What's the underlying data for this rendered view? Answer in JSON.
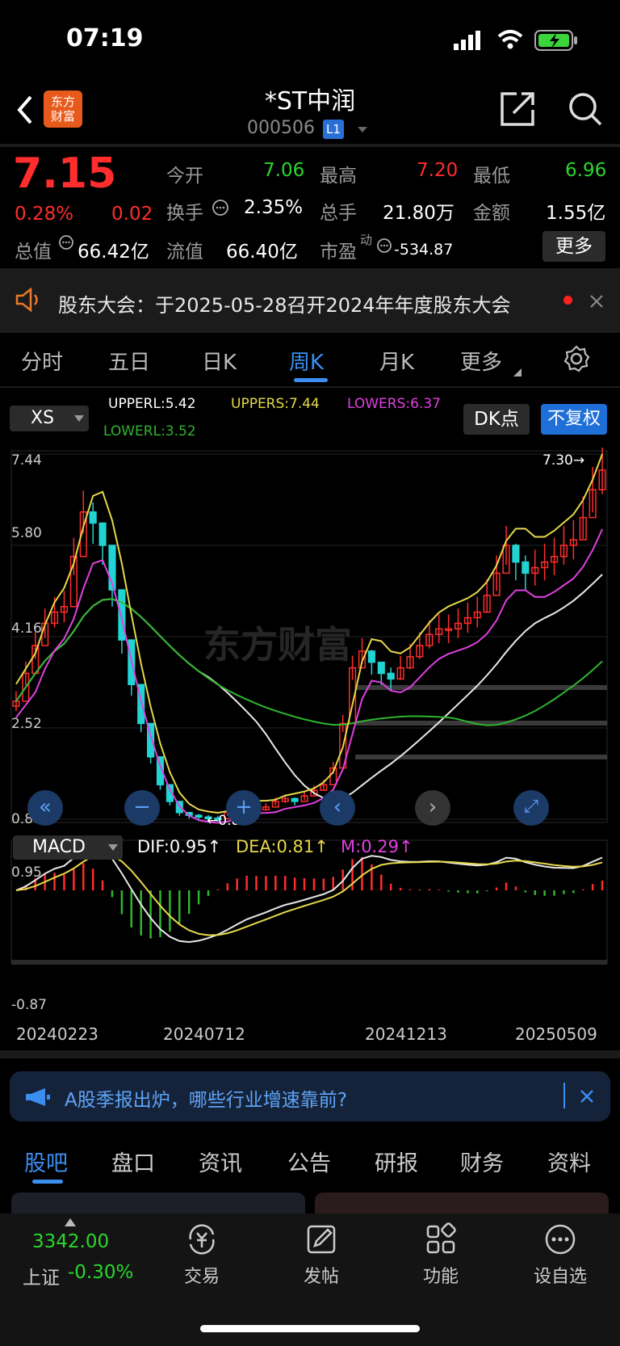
{
  "status": {
    "time": "07:19"
  },
  "header": {
    "title": "*ST中润",
    "code": "000506",
    "level": "L1",
    "logo_line1": "东方",
    "logo_line2": "财富"
  },
  "quote": {
    "price": "7.15",
    "change_pct": "0.28%",
    "change": "0.02",
    "open_label": "今开",
    "open": "7.06",
    "high_label": "最高",
    "high": "7.20",
    "low_label": "最低",
    "low": "6.96",
    "turnover_label": "换手",
    "turnover": "2.35%",
    "volume_label": "总手",
    "volume": "21.80万",
    "amount_label": "金额",
    "amount": "1.55亿",
    "mktcap_label": "总值",
    "mktcap": "66.42亿",
    "float_label": "流值",
    "float": "66.40亿",
    "pe_label": "市盈",
    "pe_sup": "动",
    "pe": "-534.87",
    "more_label": "更多"
  },
  "notice": {
    "text": "股东大会：于2025-05-28召开2024年年度股东大会"
  },
  "chart_tabs": [
    {
      "label": "分时"
    },
    {
      "label": "五日"
    },
    {
      "label": "日K"
    },
    {
      "label": "周K"
    },
    {
      "label": "月K"
    },
    {
      "label": "更多"
    }
  ],
  "chart_controls": {
    "indicator": "XS",
    "upperl": "UPPERL:5.42",
    "uppers": "UPPERS:7.44",
    "lowers": "LOWERS:6.37",
    "lowerl": "LOWERL:3.52",
    "dk": "DK点",
    "fq": "不复权"
  },
  "colors": {
    "up": "#ff2d2d",
    "down": "#22d3d3",
    "upper": "#e6d84a",
    "lower": "#e040e0",
    "ma_white": "#e8e8e8",
    "ma_green": "#2fb52f",
    "accent": "#2a8cf0"
  },
  "chart_data": {
    "type": "candlestick",
    "price_ticks": [
      "7.44",
      "5.80",
      "4.16",
      "2.52",
      "0.88"
    ],
    "price_max_label": "7.30",
    "price_min_label": "0.89",
    "watermark": "东方财富",
    "dates": [
      "20240223",
      "20240712",
      "20241213",
      "20250509"
    ],
    "macd": {
      "indicator": "MACD",
      "dif": "DIF:0.95",
      "dea": "DEA:0.81",
      "m": "M:0.29",
      "top": "0.95",
      "bottom": "-0.87"
    },
    "close": [
      3.0,
      3.5,
      4.0,
      4.4,
      4.6,
      4.7,
      5.6,
      6.4,
      6.2,
      5.8,
      5.0,
      4.1,
      3.3,
      2.6,
      2.0,
      1.5,
      1.2,
      1.0,
      0.95,
      0.92,
      0.9,
      0.89,
      1.0,
      1.1,
      1.15,
      1.05,
      1.1,
      1.2,
      1.25,
      1.2,
      1.3,
      1.4,
      1.5,
      1.8,
      2.6,
      3.6,
      3.9,
      3.7,
      3.5,
      3.4,
      3.6,
      3.8,
      4.0,
      4.2,
      4.3,
      4.3,
      4.4,
      4.5,
      4.6,
      4.9,
      5.3,
      5.8,
      5.5,
      5.3,
      5.4,
      5.5,
      5.6,
      5.8,
      5.9,
      6.3,
      6.8,
      7.15
    ]
  },
  "banner": {
    "text": "A股季报出炉，哪些行业增速靠前?"
  },
  "bottom_tabs": [
    {
      "label": "股吧"
    },
    {
      "label": "盘口"
    },
    {
      "label": "资讯"
    },
    {
      "label": "公告"
    },
    {
      "label": "研报"
    },
    {
      "label": "财务"
    },
    {
      "label": "资料"
    }
  ],
  "footer": {
    "index_value": "3342.00",
    "index_name": "上证",
    "index_change": "-0.30%",
    "items": [
      {
        "label": "交易"
      },
      {
        "label": "发帖"
      },
      {
        "label": "功能"
      },
      {
        "label": "设自选"
      }
    ]
  }
}
